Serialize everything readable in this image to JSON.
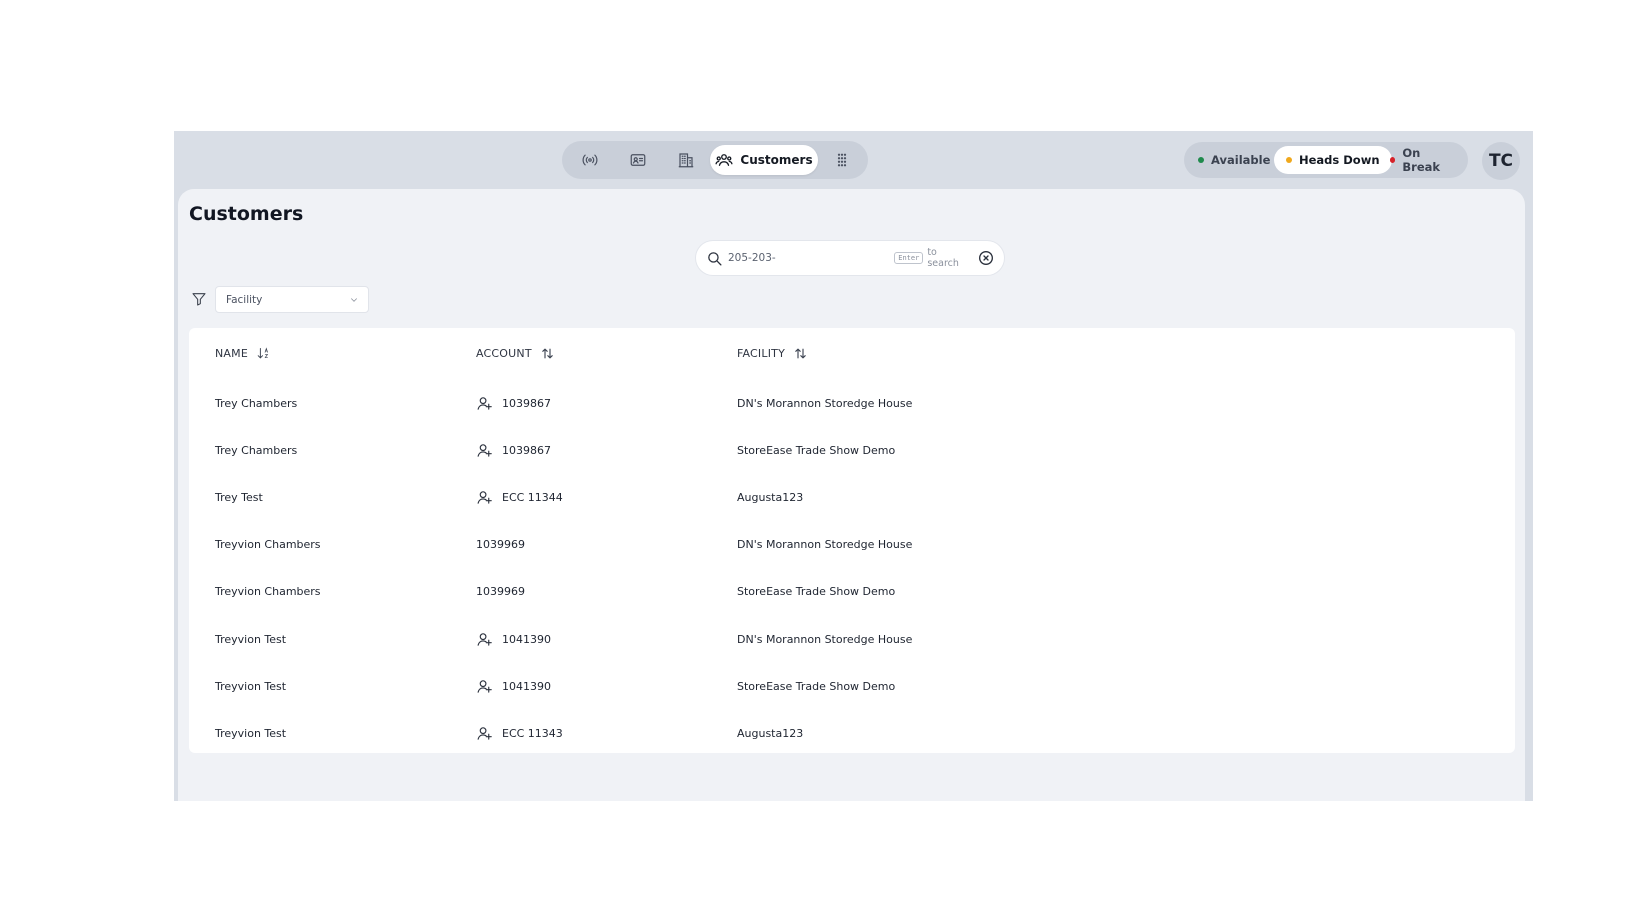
{
  "nav": {
    "items": [
      {
        "name": "broadcast-icon"
      },
      {
        "name": "id-card-icon"
      },
      {
        "name": "building-icon"
      },
      {
        "name": "users-icon",
        "label": "Customers"
      },
      {
        "name": "grid-dots-icon"
      }
    ]
  },
  "status": {
    "options": [
      {
        "label": "Available",
        "color": "#1f8a4c"
      },
      {
        "label": "Heads Down",
        "color": "#f0a81c"
      },
      {
        "label": "On Break",
        "color": "#d6222a"
      }
    ],
    "selected": "Heads Down"
  },
  "user": {
    "initials": "TC"
  },
  "page": {
    "title": "Customers"
  },
  "search": {
    "value": "205-203-",
    "kbd": "Enter",
    "hint": "to search"
  },
  "filter": {
    "facility_label": "Facility"
  },
  "table": {
    "columns": [
      {
        "label": "NAME"
      },
      {
        "label": "ACCOUNT"
      },
      {
        "label": "FACILITY"
      }
    ],
    "rows": [
      {
        "name": "Trey Chambers",
        "account": "1039867",
        "facility": "DN's Morannon Storedge House"
      },
      {
        "name": "Trey Chambers",
        "account": "1039867",
        "facility": "StoreEase Trade Show Demo"
      },
      {
        "name": "Trey Test",
        "account": "ECC 11344",
        "facility": "Augusta123"
      },
      {
        "name": "Treyvion Chambers",
        "account": "1039969",
        "facility": "DN's Morannon Storedge House"
      },
      {
        "name": "Treyvion Chambers",
        "account": "1039969",
        "facility": "StoreEase Trade Show Demo"
      },
      {
        "name": "Treyvion Test",
        "account": "1041390",
        "facility": "DN's Morannon Storedge House"
      },
      {
        "name": "Treyvion Test",
        "account": "1041390",
        "facility": "StoreEase Trade Show Demo"
      },
      {
        "name": "Treyvion Test",
        "account": "ECC 11343",
        "facility": "Augusta123"
      }
    ],
    "row_icon_flags": [
      true,
      true,
      true,
      false,
      false,
      true,
      true,
      true
    ]
  }
}
